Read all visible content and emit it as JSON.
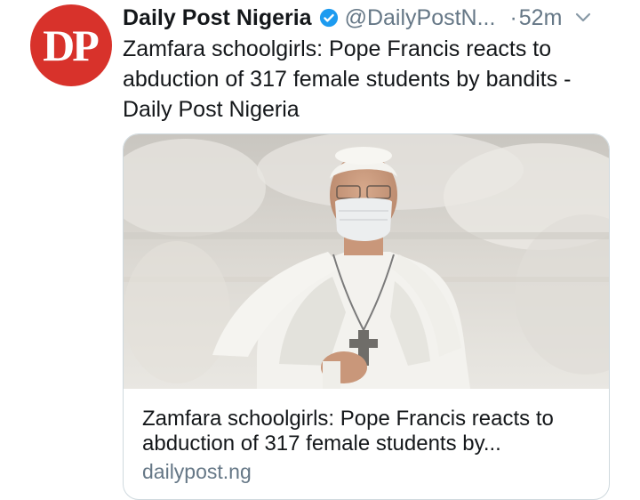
{
  "account": {
    "avatar_text": "DP",
    "name": "Daily Post Nigeria",
    "handle": "@DailyPostN...",
    "separator": "·",
    "time": "52m",
    "verified": true
  },
  "tweet": {
    "text": "Zamfara schoolgirls: Pope Francis reacts to abduction of 317 female students by bandits - Daily Post Nigeria"
  },
  "card": {
    "image_subject": "pope-wearing-mask",
    "title": "Zamfara schoolgirls: Pope Francis reacts to abduction of 317 female students by...",
    "domain": "dailypost.ng"
  },
  "colors": {
    "avatar_bg": "#d8322b",
    "verified_blue": "#1d9bf0",
    "muted_text": "#657786"
  }
}
